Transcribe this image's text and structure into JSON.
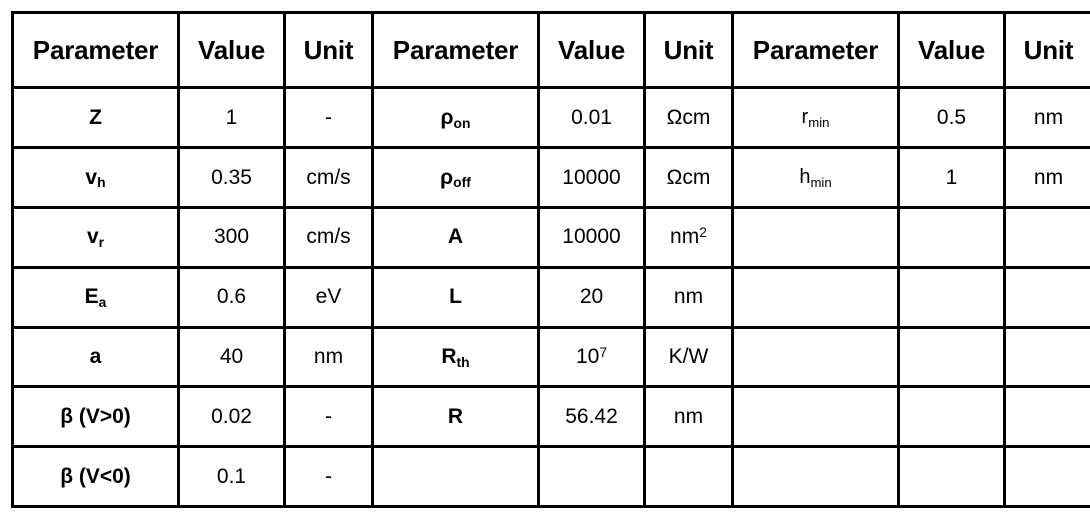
{
  "table": {
    "headers": [
      "Parameter",
      "Value",
      "Unit"
    ],
    "groups": [
      {
        "rows": [
          {
            "param": "Z",
            "param_sub": "",
            "bold": true,
            "value": "1",
            "value_sup": "",
            "unit": "-",
            "unit_sup": ""
          },
          {
            "param": "v",
            "param_sub": "h",
            "bold": true,
            "value": "0.35",
            "value_sup": "",
            "unit": "cm/s",
            "unit_sup": ""
          },
          {
            "param": "v",
            "param_sub": "r",
            "bold": true,
            "value": "300",
            "value_sup": "",
            "unit": "cm/s",
            "unit_sup": ""
          },
          {
            "param": "E",
            "param_sub": "a",
            "bold": true,
            "value": "0.6",
            "value_sup": "",
            "unit": "eV",
            "unit_sup": ""
          },
          {
            "param": "a",
            "param_sub": "",
            "bold": true,
            "value": "40",
            "value_sup": "",
            "unit": "nm",
            "unit_sup": ""
          },
          {
            "param": "β (V>0)",
            "param_sub": "",
            "bold": true,
            "value": "0.02",
            "value_sup": "",
            "unit": "-",
            "unit_sup": ""
          },
          {
            "param": "β (V<0)",
            "param_sub": "",
            "bold": true,
            "value": "0.1",
            "value_sup": "",
            "unit": "-",
            "unit_sup": ""
          }
        ]
      },
      {
        "rows": [
          {
            "param": "ρ",
            "param_sub": "on",
            "bold": true,
            "value": "0.01",
            "value_sup": "",
            "unit": "Ωcm",
            "unit_sup": ""
          },
          {
            "param": "ρ",
            "param_sub": "off",
            "bold": true,
            "value": "10000",
            "value_sup": "",
            "unit": "Ωcm",
            "unit_sup": ""
          },
          {
            "param": "A",
            "param_sub": "",
            "bold": true,
            "value": "10000",
            "value_sup": "",
            "unit": "nm",
            "unit_sup": "2"
          },
          {
            "param": "L",
            "param_sub": "",
            "bold": true,
            "value": "20",
            "value_sup": "",
            "unit": "nm",
            "unit_sup": ""
          },
          {
            "param": "R",
            "param_sub": "th",
            "bold": true,
            "value": "10",
            "value_sup": "7",
            "unit": "K/W",
            "unit_sup": ""
          },
          {
            "param": "R",
            "param_sub": "",
            "bold": true,
            "value": "56.42",
            "value_sup": "",
            "unit": "nm",
            "unit_sup": ""
          },
          {
            "param": "",
            "param_sub": "",
            "bold": true,
            "value": "",
            "value_sup": "",
            "unit": "",
            "unit_sup": ""
          }
        ]
      },
      {
        "rows": [
          {
            "param": "r",
            "param_sub": "min",
            "bold": false,
            "value": "0.5",
            "value_sup": "",
            "unit": "nm",
            "unit_sup": ""
          },
          {
            "param": "h",
            "param_sub": "min",
            "bold": false,
            "value": "1",
            "value_sup": "",
            "unit": "nm",
            "unit_sup": ""
          },
          {
            "param": "",
            "param_sub": "",
            "bold": true,
            "value": "",
            "value_sup": "",
            "unit": "",
            "unit_sup": ""
          },
          {
            "param": "",
            "param_sub": "",
            "bold": true,
            "value": "",
            "value_sup": "",
            "unit": "",
            "unit_sup": ""
          },
          {
            "param": "",
            "param_sub": "",
            "bold": true,
            "value": "",
            "value_sup": "",
            "unit": "",
            "unit_sup": ""
          },
          {
            "param": "",
            "param_sub": "",
            "bold": true,
            "value": "",
            "value_sup": "",
            "unit": "",
            "unit_sup": ""
          },
          {
            "param": "",
            "param_sub": "",
            "bold": true,
            "value": "",
            "value_sup": "",
            "unit": "",
            "unit_sup": ""
          }
        ]
      }
    ]
  },
  "style": {
    "border_color": "#000000",
    "text_color": "#000000",
    "background": "#ffffff"
  }
}
